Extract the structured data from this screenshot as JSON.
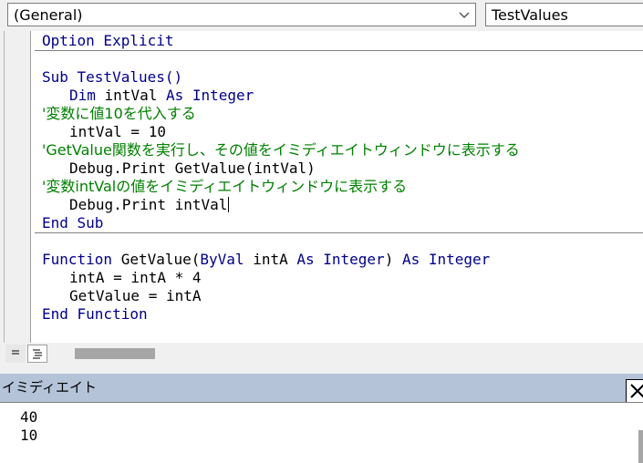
{
  "combo": {
    "object": "(General)",
    "procedure": "TestValues"
  },
  "code": {
    "option": "Option Explicit",
    "sub_decl": "Sub TestValues()",
    "dim_kw": "Dim",
    "dim_var": " intVal ",
    "dim_as": "As",
    "dim_type": " Integer",
    "comment1": "'変数に値10を代入する",
    "assign": "intVal = 10",
    "comment2": "'GetValue関数を実行し、その値をイミディエイトウィンドウに表示する",
    "debug1_kw": "Debug",
    "debug1_rest": ".Print GetValue(intVal)",
    "comment3": "'変数intValの値をイミディエイトウィンドウに表示する",
    "debug2_kw": "Debug",
    "debug2_rest": ".Print intVal",
    "end_sub": "End Sub",
    "func_kw": "Function",
    "func_name": " GetValue(",
    "func_byval": "ByVal",
    "func_param": " intA ",
    "func_as1": "As Integer",
    "func_close": ") ",
    "func_as2": "As Integer",
    "func_l1": "intA = intA * 4",
    "func_l2": "GetValue = intA",
    "end_function": "End Function"
  },
  "immediate": {
    "title": "イミディエイト",
    "output": [
      "40",
      "10"
    ]
  }
}
